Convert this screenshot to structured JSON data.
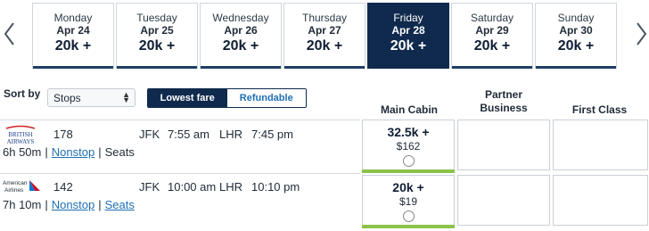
{
  "date_strip": {
    "days": [
      {
        "day": "Monday",
        "date": "Apr 24",
        "price": "20k +"
      },
      {
        "day": "Tuesday",
        "date": "Apr 25",
        "price": "20k +"
      },
      {
        "day": "Wednesday",
        "date": "Apr 26",
        "price": "20k +"
      },
      {
        "day": "Thursday",
        "date": "Apr 27",
        "price": "20k +"
      },
      {
        "day": "Friday",
        "date": "Apr 28",
        "price": "20k +",
        "selected": true
      },
      {
        "day": "Saturday",
        "date": "Apr 29",
        "price": "20k +"
      },
      {
        "day": "Sunday",
        "date": "Apr 30",
        "price": "20k +"
      }
    ],
    "prev_icon": "chevron-left-icon",
    "next_icon": "chevron-right-icon"
  },
  "sort": {
    "label": "Sort by",
    "selected": "Stops",
    "toggle": {
      "lowest_fare": "Lowest fare",
      "refundable": "Refundable",
      "active": "lowest_fare"
    }
  },
  "columns": {
    "main_cabin": "Main Cabin",
    "partner_business_line1": "Partner",
    "partner_business_line2": "Business",
    "first_class": "First Class"
  },
  "flights": [
    {
      "airline_logo_text": "BRITISH\nAIRWAYS",
      "flight_number": "178",
      "origin": "JFK",
      "depart": "7:55 am",
      "destination": "LHR",
      "arrive": "7:45 pm",
      "duration": "6h 50m",
      "stops": "Nonstop",
      "seats": "Seats",
      "main_cabin": {
        "miles": "32.5k +",
        "cash": "$162"
      }
    },
    {
      "airline_logo_text": "American\nAirlines",
      "flight_number": "142",
      "origin": "JFK",
      "depart": "10:00 am",
      "destination": "LHR",
      "arrive": "10:10 pm",
      "duration": "7h 10m",
      "stops": "Nonstop",
      "seats": "Seats",
      "main_cabin": {
        "miles": "20k +",
        "cash": "$19"
      }
    }
  ],
  "colors": {
    "selected_day_bg": "#0f2a4d",
    "link": "#1f6fb5",
    "fare_bar": "#8bc34a",
    "ba_blue": "#1c3f8a",
    "ba_red": "#d2232a",
    "aa_red": "#c8102e",
    "aa_blue": "#0078d2"
  }
}
